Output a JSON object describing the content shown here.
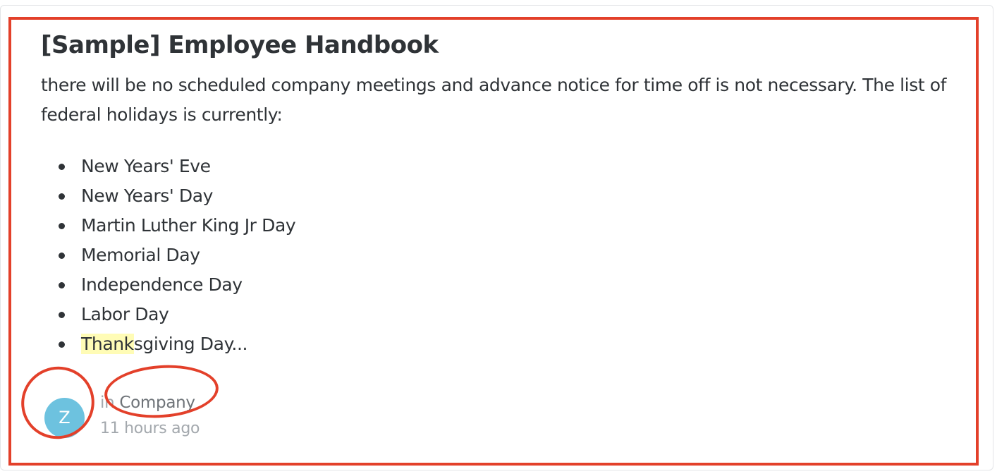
{
  "result": {
    "title": "[Sample] Employee Handbook",
    "excerpt": "there will be no scheduled company meetings and advance notice for time off is not necessary. The list of federal holidays is currently:",
    "list_items": [
      "New Years' Eve",
      "New Years' Day",
      "Martin Luther King Jr Day",
      "Memorial Day",
      "Independence Day",
      "Labor Day"
    ],
    "last_item": {
      "highlight": "Thank",
      "rest": "sgiving Day..."
    },
    "meta": {
      "avatar_initial": "Z",
      "location_prefix": "in",
      "location": "Company",
      "timestamp": "11 hours ago"
    }
  },
  "colors": {
    "annotation": "#e3402a",
    "avatar": "#6dc2df",
    "highlight": "#fffcb6"
  }
}
